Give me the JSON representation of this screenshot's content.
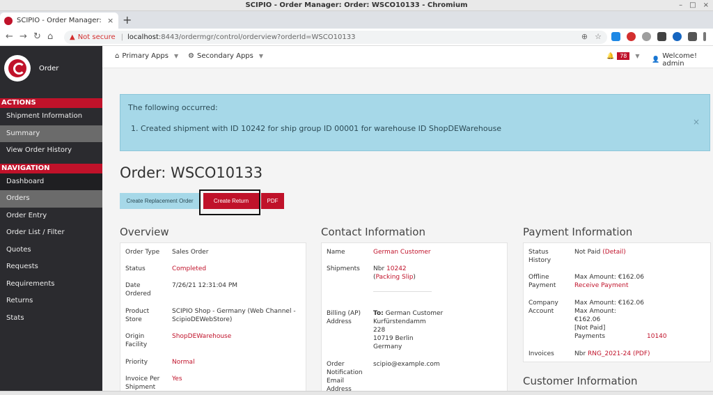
{
  "os": {
    "title": "SCIPIO - Order Manager: Order: WSCO10133 - Chromium",
    "controls": [
      "–",
      "□",
      "×"
    ]
  },
  "browser": {
    "tab_title": "SCIPIO - Order Manager: O",
    "tab_close": "×",
    "new_tab": "+",
    "back": "←",
    "forward": "→",
    "reload": "↻",
    "home": "⌂",
    "warn": "▲",
    "not_secure": "Not secure",
    "separator": "|",
    "url_host": "localhost",
    "url_rest": ":8443/ordermgr/control/orderview?orderId=WSCO10133",
    "zoom_icon": "⊕",
    "star_icon": "☆",
    "ext_colors": [
      "#1e88e5",
      "#d32f2f",
      "#9e9e9e",
      "#424242",
      "#1565c0",
      "#555555",
      "#777777"
    ]
  },
  "sidebar": {
    "brand": "Order",
    "actions_header": "ACTIONS",
    "actions": [
      {
        "label": "Shipment Information"
      },
      {
        "label": "Summary"
      },
      {
        "label": "View Order History"
      }
    ],
    "nav_header": "NAVIGATION",
    "nav": [
      {
        "label": "Dashboard"
      },
      {
        "label": "Orders"
      },
      {
        "label": "Order Entry"
      },
      {
        "label": "Order List / Filter"
      },
      {
        "label": "Quotes"
      },
      {
        "label": "Requests"
      },
      {
        "label": "Requirements"
      },
      {
        "label": "Returns"
      },
      {
        "label": "Stats"
      }
    ]
  },
  "appbar": {
    "primary_icon": "⌂",
    "primary": "Primary Apps",
    "secondary_icon": "⚙",
    "secondary": "Secondary Apps",
    "caret": "▼",
    "bell_icon": "🔔",
    "notif_count": "78",
    "user_icon": "👤",
    "welcome": "Welcome! admin"
  },
  "alert": {
    "title": "The following occurred:",
    "message": "1. Created shipment with ID 10242 for ship group ID 00001 for warehouse ID ShopDEWarehouse",
    "close": "×"
  },
  "order": {
    "title": "Order: WSCO10133",
    "buttons": {
      "replace": "Create Replacement Order",
      "return": "Create Return",
      "pdf": "PDF"
    }
  },
  "overview": {
    "title": "Overview",
    "rows": [
      {
        "label": "Order Type",
        "value": "Sales Order"
      },
      {
        "label": "Status",
        "value": "Completed"
      },
      {
        "label": "Date\nOrdered",
        "value": "7/26/21 12:31:04 PM"
      },
      {
        "label": "Product\nStore",
        "value": "SCIPIO Shop - Germany (Web Channel -\nScipioDEWebStore)"
      },
      {
        "label": "Origin\nFacility",
        "value": "ShopDEWarehouse"
      },
      {
        "label": "Priority",
        "value": "Normal"
      },
      {
        "label": "Invoice Per\nShipment",
        "value": "Yes"
      }
    ]
  },
  "contact": {
    "title": "Contact Information",
    "name_label": "Name",
    "name_value": "German Customer",
    "shipments_label": "Shipments",
    "shipments_prefix": "Nbr ",
    "shipment_id": "10242",
    "paren_open": "(",
    "packing_slip": "Packing Slip",
    "paren_close": ")",
    "billing_label": "Billing (AP)\nAddress",
    "billing_to_label": "To:",
    "billing_to_name": " German Customer",
    "billing_lines": "Kurfürstendamm\n228\n10719 Berlin\nGermany",
    "email_label": "Order\nNotification\nEmail\nAddress",
    "email_value": "scipio@example.com"
  },
  "payment": {
    "title": "Payment Information",
    "status_label": "Status\nHistory",
    "status_value": "Not Paid ",
    "detail_open": "(",
    "detail": "Detail",
    "detail_close": ")",
    "offline_label": "Offline\nPayment",
    "offline_max": "Max Amount: €162.06",
    "receive": "Receive Payment",
    "company_label": "Company\nAccount",
    "company_max": "Max Amount: €162.06\nMax Amount:\n€162.06\n [Not Paid]\n Payments",
    "payments_id": "10140",
    "invoices_label": "Invoices",
    "invoices_prefix": "Nbr ",
    "invoice_id": "RNG_2021-24",
    "invoice_pdf_open": " (",
    "invoice_pdf": "PDF",
    "invoice_pdf_close": ")"
  },
  "customer": {
    "title": "Customer Information"
  }
}
